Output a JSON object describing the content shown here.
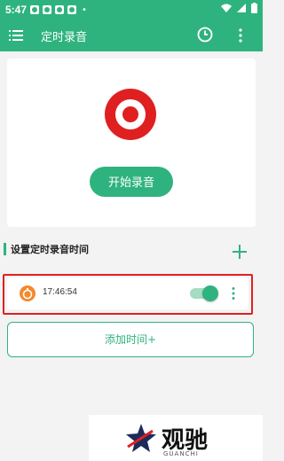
{
  "status_bar": {
    "time": "5:47"
  },
  "app_bar": {
    "title": "定时录音"
  },
  "recorder": {
    "start_label": "开始录音"
  },
  "schedule": {
    "section_title": "设置定时录音时间",
    "items": [
      {
        "time": "17:46:54",
        "enabled": true
      }
    ],
    "add_time_label": "添加时间+"
  },
  "watermark": {
    "brand": "观驰",
    "sub": "GUANCHI"
  },
  "colors": {
    "accent": "#2fb37e",
    "record_red": "#e02020",
    "highlight_border": "#e02020"
  }
}
